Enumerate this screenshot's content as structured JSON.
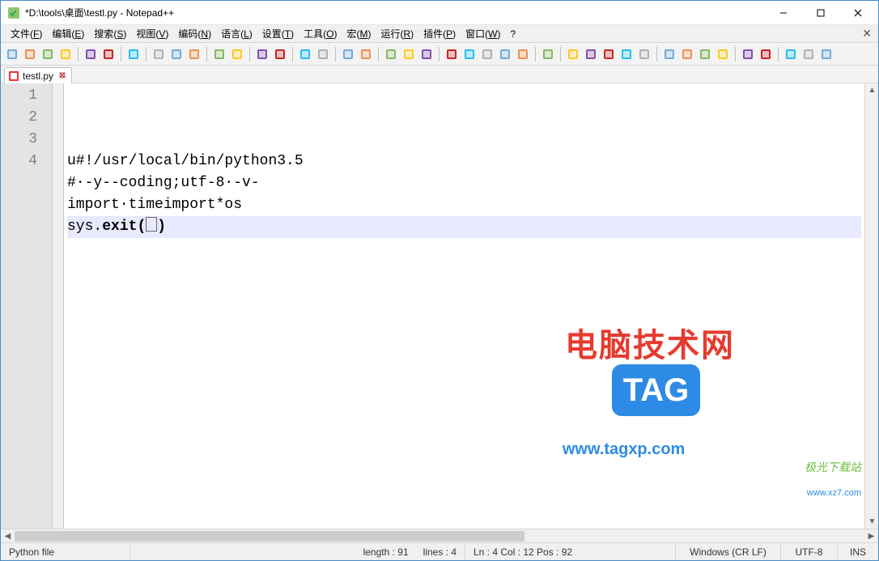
{
  "window": {
    "title": "*D:\\tools\\桌面\\testl.py - Notepad++"
  },
  "menus": [
    {
      "label": "文件",
      "key": "F"
    },
    {
      "label": "编辑",
      "key": "E"
    },
    {
      "label": "搜索",
      "key": "S"
    },
    {
      "label": "视图",
      "key": "V"
    },
    {
      "label": "编码",
      "key": "N"
    },
    {
      "label": "语言",
      "key": "L"
    },
    {
      "label": "设置",
      "key": "T"
    },
    {
      "label": "工具",
      "key": "O"
    },
    {
      "label": "宏",
      "key": "M"
    },
    {
      "label": "运行",
      "key": "R"
    },
    {
      "label": "插件",
      "key": "P"
    },
    {
      "label": "窗口",
      "key": "W"
    },
    {
      "label": "?",
      "key": ""
    }
  ],
  "toolbar_icons": [
    "new-file-icon",
    "open-file-icon",
    "save-icon",
    "save-all-icon",
    "sep",
    "close-icon",
    "close-all-icon",
    "sep",
    "print-icon",
    "sep",
    "cut-icon",
    "copy-icon",
    "paste-icon",
    "sep",
    "undo-icon",
    "redo-icon",
    "sep",
    "find-icon",
    "replace-icon",
    "sep",
    "zoom-in-icon",
    "zoom-out-icon",
    "sep",
    "sync-v-icon",
    "sync-h-icon",
    "sep",
    "wrap-icon",
    "show-all-icon",
    "indent-guide-icon",
    "sep",
    "lang-icon",
    "doc-map-icon",
    "doc-list-icon",
    "func-list-icon",
    "folder-icon",
    "sep",
    "monitor-icon",
    "sep",
    "record-icon",
    "stop-icon",
    "play-icon",
    "play-multi-icon",
    "save-macro-icon",
    "sep",
    "compare-icon",
    "clear-compare-icon",
    "nav-first-icon",
    "nav-prev-icon",
    "sep",
    "toggle-1-icon",
    "toggle-2-icon",
    "sep",
    "toggle-3-icon",
    "toggle-4-icon",
    "bold-h-icon"
  ],
  "tabs": [
    {
      "label": "testl.py",
      "dirty": true
    }
  ],
  "code_lines": [
    "u#!/usr/local/bin/python3.5",
    "#·-y--coding;utf-8·-v-",
    "import·timeimport*os",
    "sys.exit(⎕)"
  ],
  "current_line": 4,
  "status": {
    "filetype": "Python file",
    "length_label": "length : 91",
    "lines_label": "lines : 4",
    "pos_label": "Ln : 4    Col : 12    Pos : 92",
    "eol": "Windows (CR LF)",
    "encoding": "UTF-8",
    "mode": "INS"
  },
  "watermark": {
    "text": "电脑技术网",
    "url": "www.tagxp.com",
    "tag": "TAG",
    "site_cn": "极光下载站",
    "site_url": "www.xz7.com"
  }
}
